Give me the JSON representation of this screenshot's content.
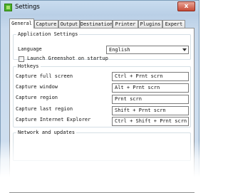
{
  "window": {
    "title": "Settings",
    "close_glyph": "x"
  },
  "tabs": [
    {
      "label": "General",
      "active": true
    },
    {
      "label": "Capture"
    },
    {
      "label": "Output"
    },
    {
      "label": "Destination"
    },
    {
      "label": "Printer"
    },
    {
      "label": "Plugins"
    },
    {
      "label": "Expert"
    }
  ],
  "app_settings": {
    "title": "Application Settings",
    "language_label": "Language",
    "language_value": "English",
    "launch_label": "Launch Greenshot on startup",
    "launch_checked": false
  },
  "hotkeys": {
    "title": "Hotkeys",
    "items": [
      {
        "label": "Capture full screen",
        "value": "Ctrl + Prnt scrn"
      },
      {
        "label": "Capture window",
        "value": "Alt + Prnt scrn"
      },
      {
        "label": "Capture region",
        "value": "Prnt scrn"
      },
      {
        "label": "Capture last region",
        "value": "Shift + Prnt scrn"
      },
      {
        "label": "Capture Internet Explorer",
        "value": "Ctrl + Shift + Prnt scrn"
      }
    ]
  },
  "network": {
    "title": "Network and updates"
  },
  "icons": {
    "app": "greenshot-app-icon",
    "close": "close-icon",
    "dropdown": "chevron-down-icon"
  }
}
